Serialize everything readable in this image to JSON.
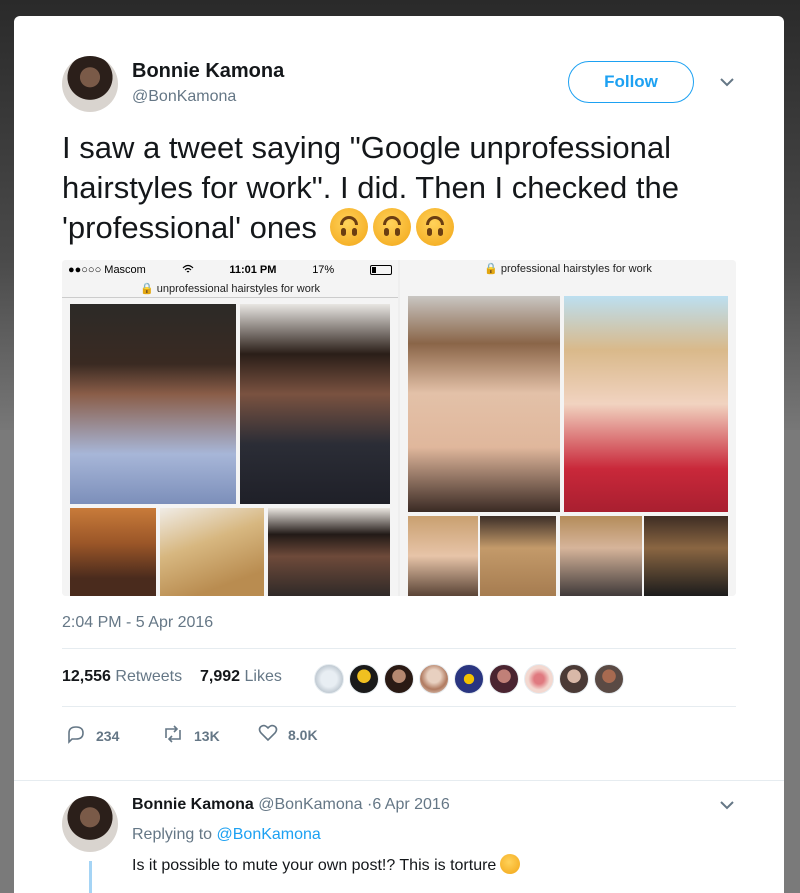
{
  "tweet": {
    "author_name": "Bonnie Kamona",
    "author_handle": "@BonKamona",
    "follow_label": "Follow",
    "text": "I saw a tweet saying \"Google unprofessional hairstyles for work\". I did. Then I checked the 'professional' ones",
    "timestamp": "2:04 PM - 5 Apr 2016",
    "retweets_count": "12,556",
    "retweets_label": "Retweets",
    "likes_count": "7,992",
    "likes_label": "Likes",
    "replies_action": "234",
    "retweets_action": "13K",
    "likes_action": "8.0K"
  },
  "media": {
    "left": {
      "carrier": "●●○○○ Mascom",
      "time": "11:01 PM",
      "battery": "17%",
      "url": "unprofessional hairstyles for work"
    },
    "right": {
      "url": "professional hairstyles for work"
    }
  },
  "reply": {
    "author_name": "Bonnie Kamona",
    "meta": "@BonKamona ·6 Apr 2016",
    "replying_prefix": "Replying to",
    "replying_handle": "@BonKamona",
    "text": "Is it possible to mute your own post!? This is torture"
  },
  "icons": {
    "caret": "chevron-down-icon",
    "reply": "reply-icon",
    "retweet": "retweet-icon",
    "like": "heart-icon",
    "lock": "lock-icon",
    "wifi": "wifi-icon"
  },
  "colors": {
    "accent": "#1da1f2",
    "text": "#14171a",
    "secondary": "#657786"
  }
}
